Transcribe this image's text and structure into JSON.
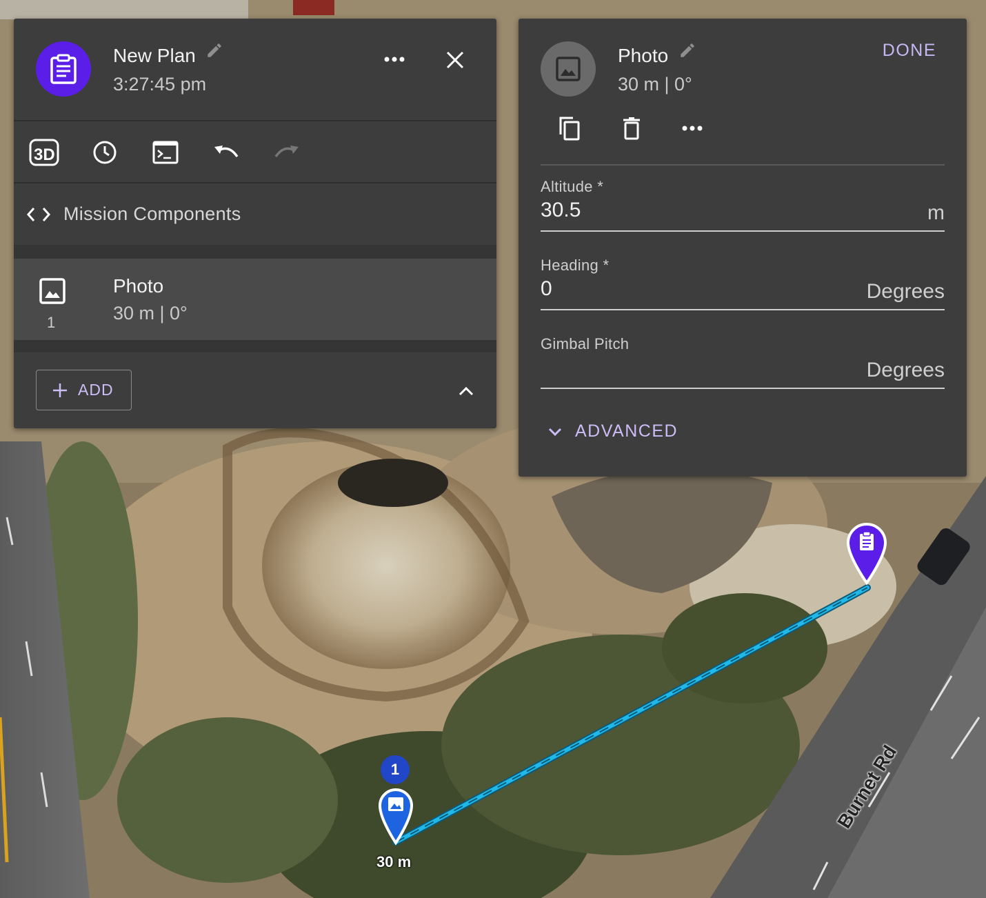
{
  "plan": {
    "title": "New Plan",
    "time": "3:27:45 pm",
    "toolbar": [
      "3d-view",
      "history",
      "console",
      "undo",
      "redo"
    ],
    "section_label": "Mission Components",
    "component": {
      "name": "Photo",
      "details": "30 m | 0°",
      "index": "1"
    },
    "add_label": "ADD"
  },
  "photo": {
    "title": "Photo",
    "details": "30 m | 0°",
    "done_label": "DONE",
    "altitude": {
      "label": "Altitude *",
      "value": "30.5",
      "unit": "m"
    },
    "heading": {
      "label": "Heading *",
      "value": "0",
      "unit": "Degrees"
    },
    "gimbal": {
      "label": "Gimbal Pitch",
      "value": "",
      "unit": "Degrees"
    },
    "advanced_label": "ADVANCED"
  },
  "map": {
    "waypoint_number": "1",
    "waypoint_altitude": "30 m",
    "road_name": "Burnet Rd",
    "path_color": "#1fb8e8",
    "plan_marker_color": "#5b1ee8",
    "photo_marker_color": "#1e63e0"
  }
}
